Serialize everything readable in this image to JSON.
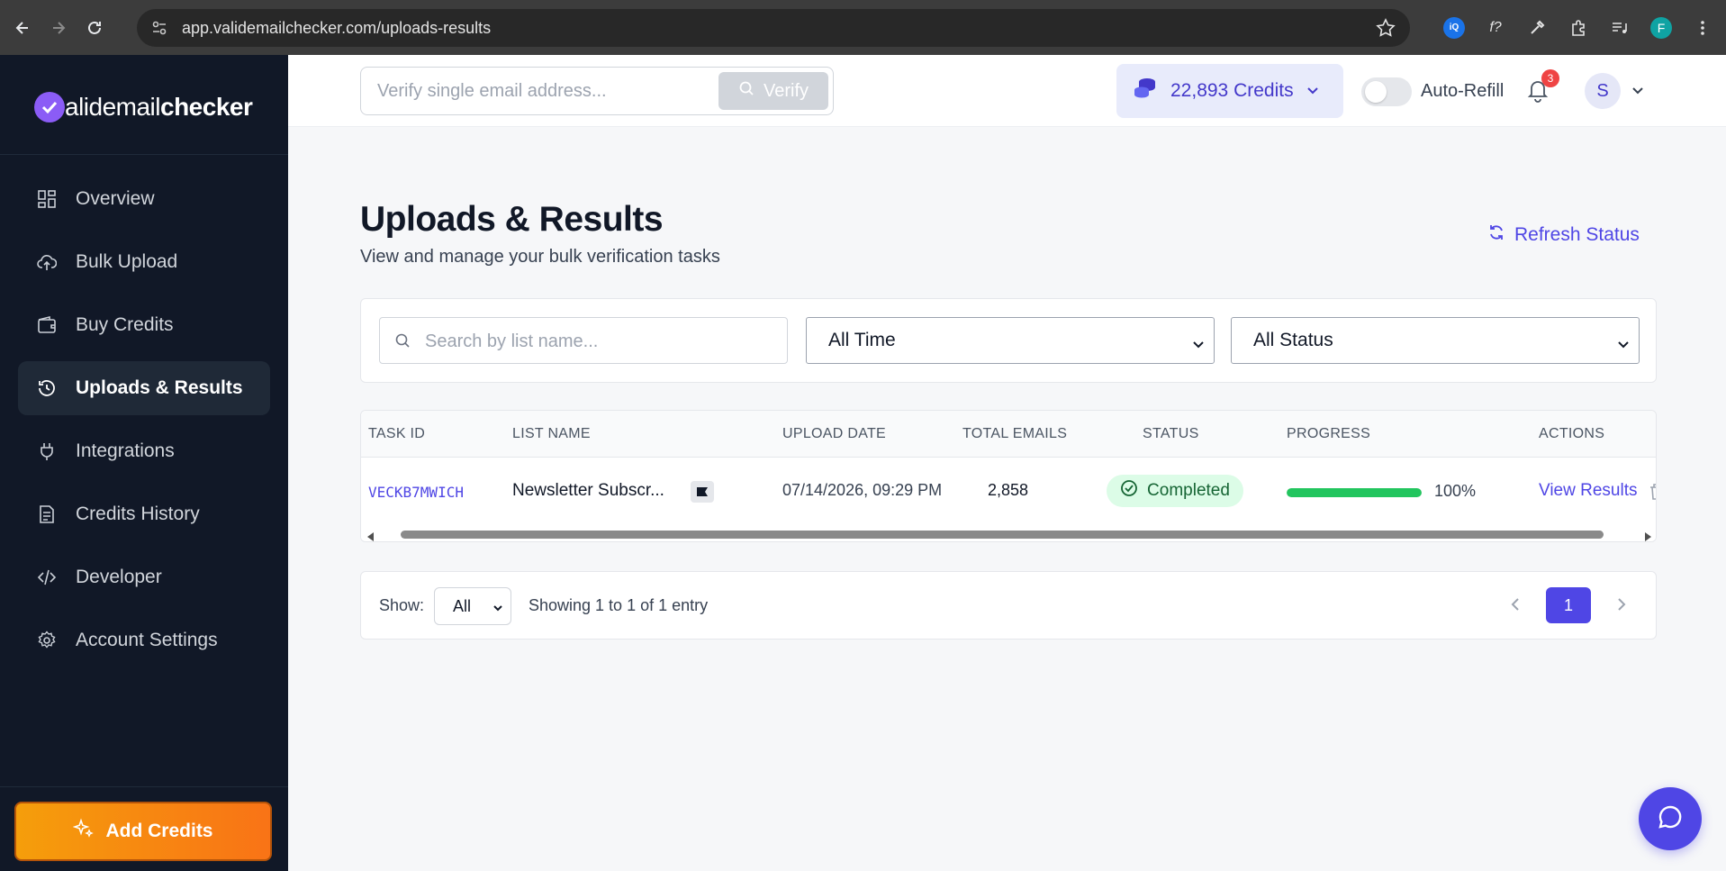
{
  "browser": {
    "url": "app.validemailchecker.com/uploads-results",
    "profile_initial": "F"
  },
  "brand": {
    "part1": "alidemail",
    "part2": "checker"
  },
  "sidebar": {
    "items": [
      {
        "label": "Overview",
        "icon": "dashboard-icon"
      },
      {
        "label": "Bulk Upload",
        "icon": "cloud-upload-icon"
      },
      {
        "label": "Buy Credits",
        "icon": "wallet-icon"
      },
      {
        "label": "Uploads & Results",
        "icon": "history-icon",
        "active": true
      },
      {
        "label": "Integrations",
        "icon": "plug-icon"
      },
      {
        "label": "Credits History",
        "icon": "receipt-icon"
      },
      {
        "label": "Developer",
        "icon": "code-icon"
      },
      {
        "label": "Account Settings",
        "icon": "gear-icon"
      }
    ],
    "add_credits_label": "Add Credits"
  },
  "header": {
    "verify_placeholder": "Verify single email address...",
    "verify_label": "Verify",
    "credits_label": "22,893 Credits",
    "auto_refill_label": "Auto-Refill",
    "auto_refill_on": false,
    "notification_count": "3",
    "avatar_initial": "S"
  },
  "page": {
    "title": "Uploads & Results",
    "subtitle": "View and manage your bulk verification tasks",
    "refresh_label": "Refresh Status"
  },
  "filters": {
    "search_placeholder": "Search by list name...",
    "time_value": "All Time",
    "status_value": "All Status"
  },
  "table": {
    "columns": [
      "TASK ID",
      "LIST NAME",
      "UPLOAD DATE",
      "TOTAL EMAILS",
      "STATUS",
      "PROGRESS",
      "ACTIONS"
    ],
    "rows": [
      {
        "task_id": "VECKB7MWICH",
        "list_name": "Newsletter Subscr...",
        "upload_date": "07/14/2026, 09:29 PM",
        "total_emails": "2,858",
        "status": "Completed",
        "progress": 1.0,
        "progress_label": "100%",
        "action": "View Results"
      }
    ]
  },
  "pagination": {
    "show_label": "Show:",
    "show_value": "All",
    "showing_text": "Showing 1 to 1 of 1 entry",
    "current_page": "1"
  },
  "colors": {
    "accent": "#4f46e5",
    "sidebar_bg": "#111827",
    "success": "#22c55e",
    "add_credits": "#f97316"
  }
}
